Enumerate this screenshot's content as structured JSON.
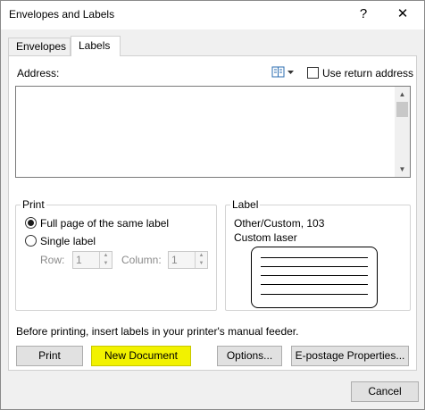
{
  "window": {
    "title": "Envelopes and Labels",
    "help": "?",
    "close": "✕"
  },
  "tabs": [
    {
      "label": "Envelopes"
    },
    {
      "label": "Labels"
    }
  ],
  "address": {
    "label": "Address:",
    "value": "",
    "use_return_label": "Use return address",
    "use_return_checked": false
  },
  "print_group": {
    "title": "Print",
    "full_page_label": "Full page of the same label",
    "single_label": "Single label",
    "row_label": "Row:",
    "row_value": "1",
    "column_label": "Column:",
    "column_value": "1",
    "selected": "full_page"
  },
  "label_group": {
    "title": "Label",
    "name": "Other/Custom, 103",
    "type": "Custom laser"
  },
  "note": "Before printing, insert labels in your printer's manual feeder.",
  "buttons": {
    "print": "Print",
    "new_document": "New Document",
    "options": "Options...",
    "epostage": "E-postage Properties...",
    "cancel": "Cancel"
  },
  "colors": {
    "highlight": "#f2f200"
  }
}
